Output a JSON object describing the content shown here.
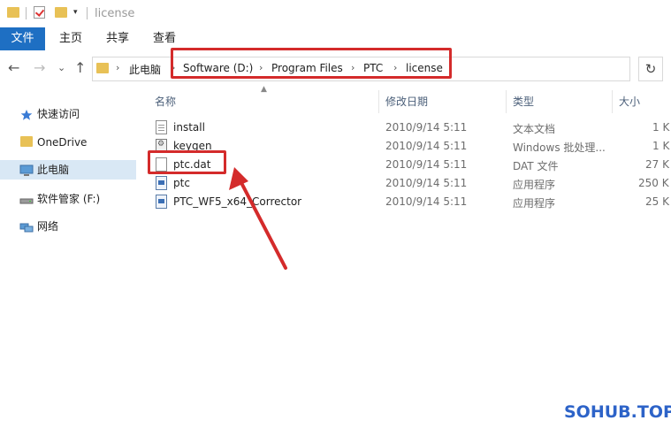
{
  "window": {
    "title": "license"
  },
  "ribbon": {
    "tabs": [
      "文件",
      "主页",
      "共享",
      "查看"
    ]
  },
  "nav": {
    "back_icon": "←",
    "forward_icon": "→",
    "recent_icon": "⌄",
    "up_icon": "↑",
    "refresh_icon": "↻",
    "breadcrumb": [
      "此电脑",
      "Software (D:)",
      "Program Files",
      "PTC",
      "license"
    ],
    "crumb_separator": "›"
  },
  "sidebar": {
    "items": [
      {
        "label": "快速访问",
        "icon": "star-icon"
      },
      {
        "label": "OneDrive",
        "icon": "folder-icon"
      },
      {
        "label": "此电脑",
        "icon": "computer-icon",
        "selected": true
      },
      {
        "label": "软件管家 (F:)",
        "icon": "drive-icon"
      },
      {
        "label": "网络",
        "icon": "network-icon"
      }
    ]
  },
  "columns": {
    "name": "名称",
    "modified": "修改日期",
    "type": "类型",
    "size": "大小"
  },
  "files": [
    {
      "name": "install",
      "modified": "2010/9/14 5:11",
      "type": "文本文档",
      "size": "1 K",
      "icon": "text-file-icon"
    },
    {
      "name": "keygen",
      "modified": "2010/9/14 5:11",
      "type": "Windows 批处理...",
      "size": "1 K",
      "icon": "batch-file-icon"
    },
    {
      "name": "ptc.dat",
      "modified": "2010/9/14 5:11",
      "type": "DAT 文件",
      "size": "27 K",
      "icon": "file-icon"
    },
    {
      "name": "ptc",
      "modified": "2010/9/14 5:11",
      "type": "应用程序",
      "size": "250 K",
      "icon": "app-icon"
    },
    {
      "name": "PTC_WF5_x64_Corrector",
      "modified": "2010/9/14 5:11",
      "type": "应用程序",
      "size": "25 K",
      "icon": "app-icon"
    }
  ],
  "annotation": {
    "color": "#d42b2b"
  },
  "accent": "#1e6fc3",
  "watermark": "SOHUB.TOP"
}
